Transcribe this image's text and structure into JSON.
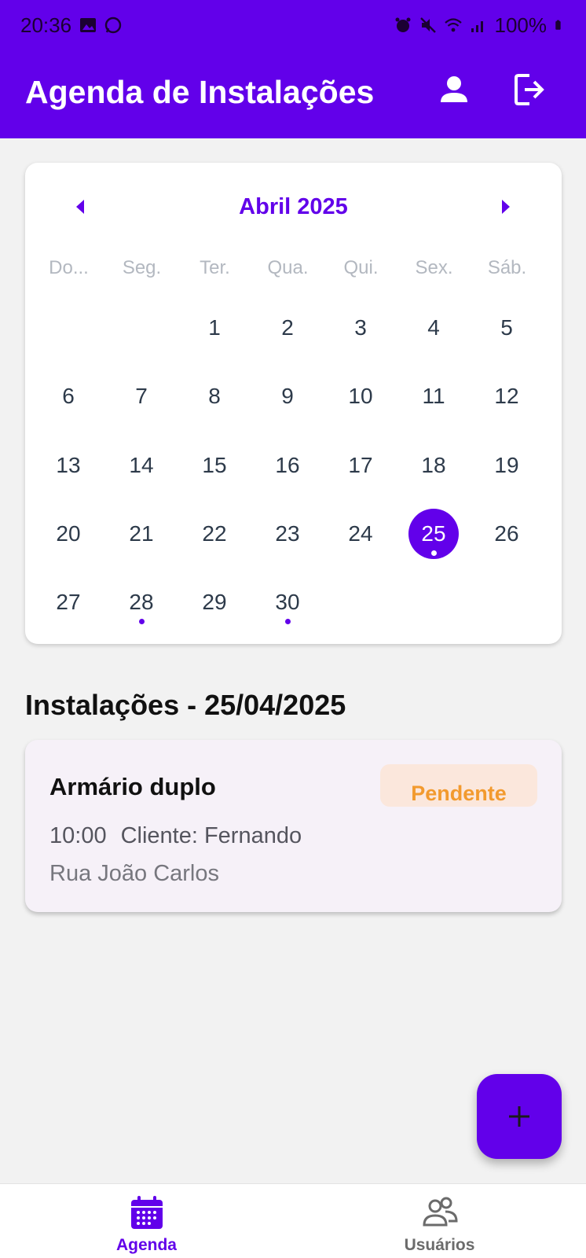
{
  "status_bar": {
    "time": "20:36",
    "battery": "100%"
  },
  "app_bar": {
    "title": "Agenda de Instalações"
  },
  "calendar": {
    "month_label": "Abril 2025",
    "weekdays": [
      "Do...",
      "Seg.",
      "Ter.",
      "Qua.",
      "Qui.",
      "Sex.",
      "Sáb."
    ],
    "first_weekday_index": 2,
    "days_in_month": 30,
    "selected_day": 25,
    "days_with_events": [
      25,
      28,
      30
    ]
  },
  "section_title": "Instalações - 25/04/2025",
  "installation": {
    "title": "Armário duplo",
    "status": "Pendente",
    "time": "10:00",
    "client": "Cliente: Fernando",
    "address": "Rua João Carlos"
  },
  "fab": {
    "icon": "plus-icon"
  },
  "bottom_nav": {
    "items": [
      {
        "label": "Agenda",
        "icon": "calendar-icon",
        "active": true
      },
      {
        "label": "Usuários",
        "icon": "users-icon",
        "active": false
      }
    ]
  },
  "colors": {
    "primary": "#6200ea",
    "badge_bg": "#fbe7dc",
    "badge_text": "#f29a2e",
    "inactive": "#6b6b6b"
  }
}
